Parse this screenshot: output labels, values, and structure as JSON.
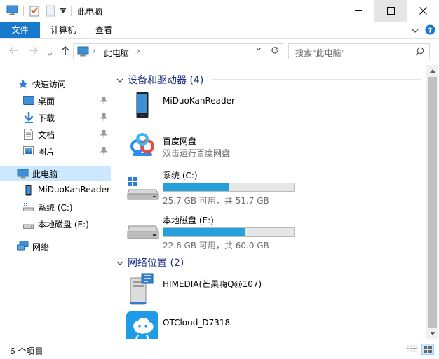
{
  "window": {
    "title": "此电脑",
    "minimize_label": "—",
    "maximize_label": "☐",
    "close_label": "✕"
  },
  "ribbon": {
    "tabs": [
      {
        "label": "文件"
      },
      {
        "label": "计算机"
      },
      {
        "label": "查看"
      }
    ]
  },
  "address": {
    "crumb_root_chevron": "›",
    "crumb": "此电脑",
    "crumb_chevron": "›",
    "dropdown_chevron": "⌄",
    "search_placeholder": "搜索\"此电脑\""
  },
  "nav": {
    "quick_access": "快速访问",
    "desktop": "桌面",
    "downloads": "下载",
    "documents": "文档",
    "pictures": "图片",
    "this_pc": "此电脑",
    "device": "MiDuoKanReader",
    "drive_c": "系统 (C:)",
    "drive_e": "本地磁盘 (E:)",
    "network": "网络"
  },
  "groups": {
    "devices": {
      "title": "设备和驱动器 (4)"
    },
    "network": {
      "title": "网络位置 (2)"
    }
  },
  "items": {
    "reader": {
      "name": "MiDuoKanReader"
    },
    "baidu": {
      "name": "百度网盘",
      "sub": "双击运行百度网盘"
    },
    "drive_c": {
      "name": "系统 (C:)",
      "free": "25.7 GB 可用，共 51.7 GB",
      "used_fraction": 0.503
    },
    "drive_e": {
      "name": "本地磁盘 (E:)",
      "free": "22.6 GB 可用，共 60.0 GB",
      "used_fraction": 0.623
    },
    "himedia": {
      "name": "HIMEDIA(芒果嗨Q@107)"
    },
    "otcloud": {
      "name": "OTCloud_D7318"
    }
  },
  "status": {
    "count": "6 个项目"
  },
  "colors": {
    "accent": "#1979ca",
    "bar_fill": "#26a0da",
    "group_title": "#1e3287",
    "selection": "#cce8ff"
  }
}
